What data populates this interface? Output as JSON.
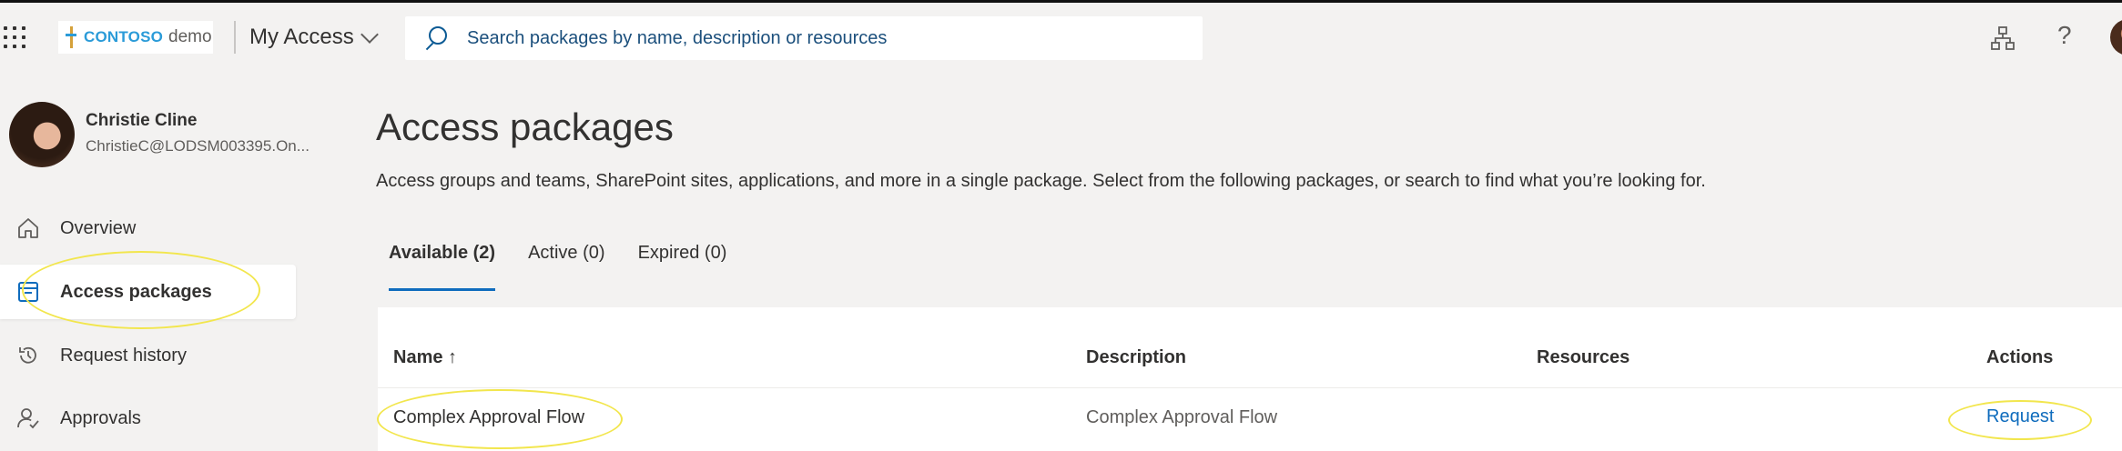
{
  "header": {
    "brand": "CONTOSO",
    "brand_suffix": "demo",
    "app_title": "My Access",
    "search_placeholder": "Search packages by name, description or resources",
    "help_glyph": "?"
  },
  "icons": {
    "app_launcher": "waffle-icon",
    "search": "search-icon",
    "org": "hierarchy-icon",
    "help": "help-icon",
    "overview": "home-icon",
    "access_packages": "package-icon",
    "request_history": "history-icon",
    "approvals": "approvals-icon"
  },
  "colors": {
    "accent": "#0f6cbd",
    "brand": "#2b9bd8",
    "highlight": "#f2e64d",
    "background": "#f3f2f1"
  },
  "user": {
    "name": "Christie Cline",
    "email": "ChristieC@LODSM003395.On..."
  },
  "sidebar": {
    "items": [
      {
        "label": "Overview",
        "active": false
      },
      {
        "label": "Access packages",
        "active": true
      },
      {
        "label": "Request history",
        "active": false
      },
      {
        "label": "Approvals",
        "active": false
      }
    ]
  },
  "main": {
    "title": "Access packages",
    "description": "Access groups and teams, SharePoint sites, applications, and more in a single package. Select from the following packages, or search to find what you’re looking for.",
    "tabs": [
      {
        "label": "Available (2)",
        "selected": true
      },
      {
        "label": "Active (0)",
        "selected": false
      },
      {
        "label": "Expired (0)",
        "selected": false
      }
    ],
    "table": {
      "columns": [
        "Name ↑",
        "Description",
        "Resources",
        "Actions"
      ],
      "rows": [
        {
          "name": "Complex Approval Flow",
          "description": "Complex Approval Flow",
          "resources": "",
          "action": "Request"
        }
      ]
    }
  }
}
